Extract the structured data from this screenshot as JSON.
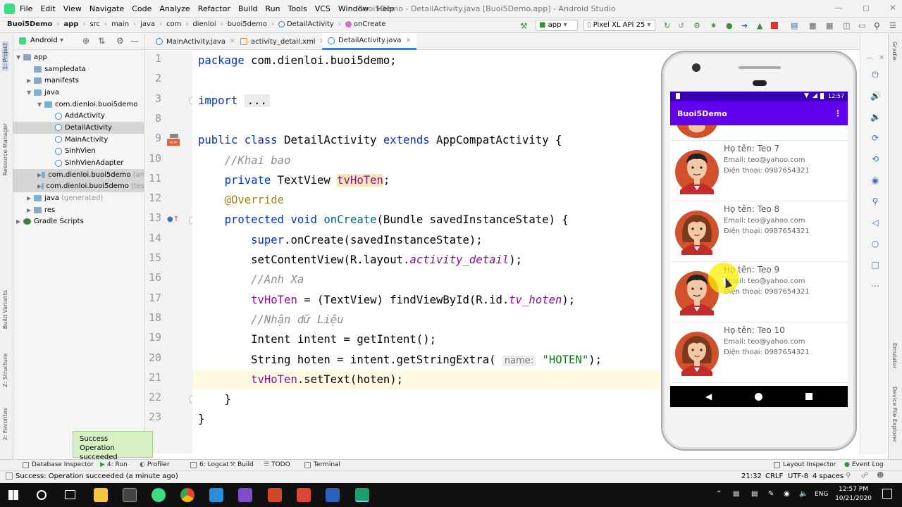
{
  "window": {
    "title": "Buoi5Demo - DetailActivity.java [Buoi5Demo.app] - Android Studio",
    "menus": [
      "File",
      "Edit",
      "View",
      "Navigate",
      "Code",
      "Analyze",
      "Refactor",
      "Build",
      "Run",
      "Tools",
      "VCS",
      "Window",
      "Help"
    ]
  },
  "breadcrumb": [
    "Buoi5Demo",
    "app",
    "src",
    "main",
    "java",
    "com",
    "dienloi",
    "buoi5demo",
    "DetailActivity",
    "onCreate"
  ],
  "toolbar": {
    "run_config": "app",
    "device": "Pixel XL API 25"
  },
  "left_strip": [
    "1: Project",
    "Resource Manager",
    "Build Variants",
    "Z: Structure",
    "2: Favorites"
  ],
  "project": {
    "view_mode": "Android",
    "tree": [
      {
        "label": "app",
        "depth": 0,
        "icon": "folder",
        "open": true
      },
      {
        "label": "sampledata",
        "depth": 1,
        "icon": "folder"
      },
      {
        "label": "manifests",
        "depth": 1,
        "icon": "folder",
        "collapsed": true
      },
      {
        "label": "java",
        "depth": 1,
        "icon": "jfolder",
        "open": true
      },
      {
        "label": "com.dienloi.buoi5demo",
        "depth": 2,
        "icon": "jfolder",
        "open": true
      },
      {
        "label": "AddActivity",
        "depth": 3,
        "icon": "cls"
      },
      {
        "label": "DetailActivity",
        "depth": 3,
        "icon": "cls",
        "selected": true
      },
      {
        "label": "MainActivity",
        "depth": 3,
        "icon": "cls"
      },
      {
        "label": "SinhVien",
        "depth": 3,
        "icon": "cls"
      },
      {
        "label": "SinhVienAdapter",
        "depth": 3,
        "icon": "cls"
      },
      {
        "label": "com.dienloi.buoi5demo",
        "suffix": "(an",
        "depth": 2,
        "icon": "jfolder",
        "collapsed": true,
        "selected": true
      },
      {
        "label": "com.dienloi.buoi5demo",
        "suffix": "(tes",
        "depth": 2,
        "icon": "jfolder",
        "collapsed": true,
        "selected": true
      },
      {
        "label": "java",
        "suffix": "(generated)",
        "depth": 1,
        "icon": "jfolder",
        "collapsed": true
      },
      {
        "label": "res",
        "depth": 1,
        "icon": "folder",
        "collapsed": true
      },
      {
        "label": "Gradle Scripts",
        "depth": 0,
        "icon": "grad",
        "collapsed": true
      }
    ]
  },
  "tabs": [
    {
      "label": "MainActivity.java",
      "icon": "class"
    },
    {
      "label": "activity_detail.xml",
      "icon": "xml"
    },
    {
      "label": "DetailActivity.java",
      "icon": "class",
      "active": true
    }
  ],
  "code": {
    "line_numbers": [
      "1",
      "2",
      "3",
      "8",
      "9",
      "10",
      "11",
      "12",
      "13",
      "14",
      "15",
      "16",
      "17",
      "18",
      "19",
      "20",
      "21",
      "22",
      "23"
    ],
    "lines": [
      [
        [
          "kw",
          "package "
        ],
        [
          "",
          "com.dienloi.buoi5demo;"
        ]
      ],
      [],
      [
        [
          "kw",
          "import "
        ],
        [
          "fold",
          "..."
        ]
      ],
      [],
      [
        [
          "kw",
          "public class "
        ],
        [
          "",
          "DetailActivity "
        ],
        [
          "kw",
          "extends "
        ],
        [
          "",
          "AppCompatActivity {"
        ]
      ],
      [
        [
          "",
          "    "
        ],
        [
          "cm",
          "//Khai bao"
        ]
      ],
      [
        [
          "",
          "    "
        ],
        [
          "kw",
          "private "
        ],
        [
          "",
          "TextView "
        ],
        [
          "fldhl",
          "tvHoTen"
        ],
        [
          "",
          ";"
        ]
      ],
      [
        [
          "",
          "    "
        ],
        [
          "an",
          "@Override"
        ]
      ],
      [
        [
          "",
          "    "
        ],
        [
          "kw",
          "protected void "
        ],
        [
          "fn",
          "onCreate"
        ],
        [
          "",
          "(Bundle savedInstanceState) {"
        ]
      ],
      [
        [
          "",
          "        "
        ],
        [
          "kw",
          "super"
        ],
        [
          "",
          ".onCreate(savedInstanceState);"
        ]
      ],
      [
        [
          "",
          "        setContentView(R.layout."
        ],
        [
          "sf",
          "activity_detail"
        ],
        [
          "",
          ");"
        ]
      ],
      [
        [
          "",
          "        "
        ],
        [
          "cm",
          "//Anh Xa"
        ]
      ],
      [
        [
          "",
          "        "
        ],
        [
          "fld",
          "tvHoTen"
        ],
        [
          "",
          " = (TextView) findViewById(R.id."
        ],
        [
          "sf",
          "tv_hoten"
        ],
        [
          "",
          ");"
        ]
      ],
      [
        [
          "",
          "        "
        ],
        [
          "cm",
          "//Nhận dữ Liệu"
        ]
      ],
      [
        [
          "",
          "        Intent intent = getIntent();"
        ]
      ],
      [
        [
          "",
          "        String hoten = intent.getStringExtra( "
        ],
        [
          "hint",
          "name:"
        ],
        [
          "",
          " "
        ],
        [
          "st",
          "\"HOTEN\""
        ],
        [
          "",
          ");"
        ]
      ],
      [
        [
          "",
          "        "
        ],
        [
          "fld",
          "tvHoTen"
        ],
        [
          "",
          ".setText(hoten);"
        ]
      ],
      [
        [
          "",
          "    }"
        ]
      ],
      [
        [
          "",
          "}"
        ]
      ]
    ],
    "current_line_index": 16
  },
  "emulator": {
    "status_time": "12:57",
    "app_title": "Buoi5Demo",
    "items": [
      {
        "name": "Họ tên: Teo 7",
        "email": "Email: teo@yahoo.com",
        "phone": "Điện thoại: 0987654321",
        "gender": "male"
      },
      {
        "name": "Họ tên: Teo 8",
        "email": "Email: teo@yahoo.com",
        "phone": "Điện thoại: 0987654321",
        "gender": "female"
      },
      {
        "name": "Họ tên: Teo 9",
        "email": "Email: teo@yahoo.com",
        "phone": "Điện thoại: 0987654321",
        "gender": "male"
      },
      {
        "name": "Họ tên: Teo 10",
        "email": "Email: teo@yahoo.com",
        "phone": "Điện thoại: 0987654321",
        "gender": "female"
      }
    ]
  },
  "right_strip": [
    "Gradle",
    "Emulator",
    "Device File Explorer"
  ],
  "bottom_tools": [
    "Database Inspector",
    "4: Run",
    "Profiler",
    "6: Logcat",
    "Build",
    "TODO",
    "Terminal"
  ],
  "bottom_tools_right": [
    "Layout Inspector",
    "Event Log"
  ],
  "toast": {
    "title": "Success",
    "message": "Operation succeeded"
  },
  "statusline": {
    "message": "Success: Operation succeeded (a minute ago)",
    "position": "21:32",
    "line_sep": "CRLF",
    "encoding": "UTF-8",
    "indent": "4 spaces"
  },
  "taskbar": {
    "lang": "ENG",
    "time": "12:57 PM",
    "date": "10/21/2020"
  },
  "colors": {
    "keyword": "#0033b3",
    "comment": "#8c8c8c",
    "field": "#871094",
    "string": "#067d17",
    "annotation": "#9e880d",
    "app_bar": "#6200ee",
    "status_bar": "#3700b3"
  }
}
